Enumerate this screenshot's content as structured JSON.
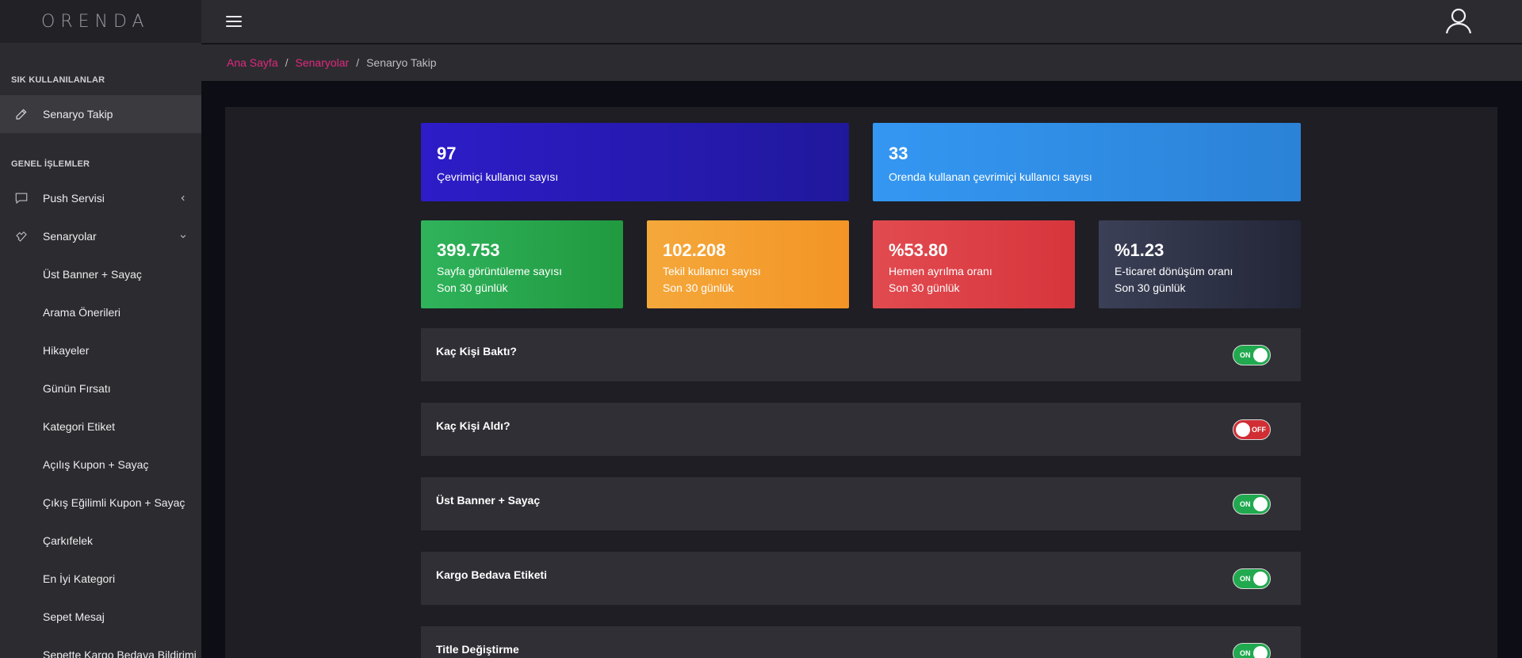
{
  "brand": {
    "logo_text": "ORENDA"
  },
  "sidebar": {
    "section_frequent": "SIK KULLANILANLAR",
    "frequent_items": [
      {
        "label": "Senaryo Takip",
        "icon": "pencil-icon"
      }
    ],
    "section_general": "GENEL İŞLEMLER",
    "general_items": [
      {
        "label": "Push Servisi",
        "icon": "comment-icon",
        "chevron": "chevron-left-icon"
      },
      {
        "label": "Senaryolar",
        "icon": "hand-icon",
        "chevron": "chevron-down-icon"
      }
    ],
    "sub_items": [
      {
        "label": "Üst Banner + Sayaç"
      },
      {
        "label": "Arama Önerileri"
      },
      {
        "label": "Hikayeler"
      },
      {
        "label": "Günün Fırsatı"
      },
      {
        "label": "Kategori Etiket"
      },
      {
        "label": "Açılış Kupon + Sayaç"
      },
      {
        "label": "Çıkış Eğilimli Kupon + Sayaç"
      },
      {
        "label": "Çarkıfelek"
      },
      {
        "label": "En İyi Kategori"
      },
      {
        "label": "Sepet Mesaj"
      },
      {
        "label": "Sepette Kargo Bedava Bildirimi"
      }
    ]
  },
  "breadcrumb": {
    "home": "Ana Sayfa",
    "separator": "/",
    "parent": "Senaryolar",
    "current": "Senaryo Takip"
  },
  "stats": {
    "online_users": {
      "value": "97",
      "label": "Çevrimiçi kullanıcı sayısı"
    },
    "orenda_online_users": {
      "value": "33",
      "label": "Orenda kullanan çevrimiçi kullanıcı sayısı"
    },
    "page_views": {
      "value": "399.753",
      "label": "Sayfa görüntüleme sayısı",
      "period": "Son 30 günlük"
    },
    "unique_users": {
      "value": "102.208",
      "label": "Tekil kullanıcı sayısı",
      "period": "Son 30 günlük"
    },
    "bounce_rate": {
      "value": "%53.80",
      "label": "Hemen ayrılma oranı",
      "period": "Son 30 günlük"
    },
    "conversion_rate": {
      "value": "%1.23",
      "label": "E-ticaret dönüşüm oranı",
      "period": "Son 30 günlük"
    }
  },
  "scenarios": [
    {
      "title": "Kaç Kişi Baktı?",
      "state": "ON",
      "enabled": true
    },
    {
      "title": "Kaç Kişi Aldı?",
      "state": "OFF",
      "enabled": false
    },
    {
      "title": "Üst Banner + Sayaç",
      "state": "ON",
      "enabled": true
    },
    {
      "title": "Kargo Bedava Etiketi",
      "state": "ON",
      "enabled": true
    },
    {
      "title": "Title Değiştirme",
      "state": "ON",
      "enabled": true
    }
  ],
  "colors": {
    "accent_link": "#e0287e",
    "toggle_on": "#21a94f",
    "toggle_off": "#d02e34",
    "card_purple": "#2d1cc8",
    "card_blue": "#3497f2",
    "card_green": "#2fb35b",
    "card_orange": "#f5a83a",
    "card_red": "#e14b50",
    "card_navy": "#3b4057"
  }
}
